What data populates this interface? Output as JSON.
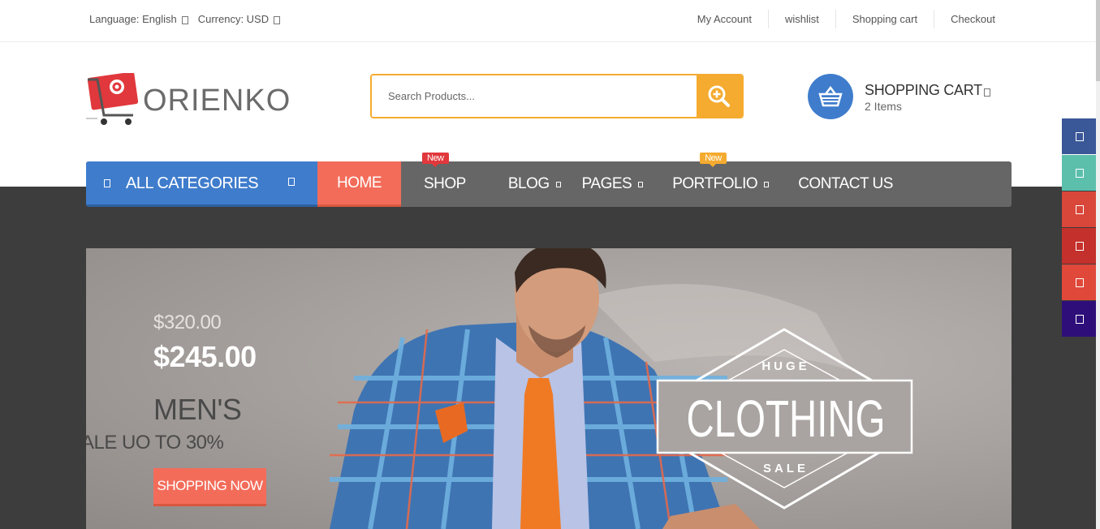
{
  "topbar": {
    "language": "Language: English",
    "currency": "Currency: USD",
    "links": [
      "My Account",
      "wishlist",
      "Shopping cart",
      "Checkout"
    ]
  },
  "logo": {
    "text": "ORIENKO"
  },
  "search": {
    "placeholder": "Search Products..."
  },
  "cart": {
    "title": "SHOPPING CART",
    "items": "2 Items"
  },
  "nav": {
    "categories_label": "ALL CATEGORIES",
    "items": [
      {
        "label": "HOME"
      },
      {
        "label": "SHOP",
        "badge": "New"
      },
      {
        "label": "BLOG"
      },
      {
        "label": "PAGES"
      },
      {
        "label": "PORTFOLIO",
        "badge": "New"
      },
      {
        "label": "CONTACT US"
      }
    ]
  },
  "hero": {
    "old_price": "$320.00",
    "price": "$245.00",
    "title": "MEN'S",
    "subtitle": "ALE UO TO 30%",
    "button": "SHOPPING NOW",
    "badge_top": "HUGE",
    "badge_main": "CLOTHING",
    "badge_bottom": "SALE"
  },
  "colors": {
    "accent_orange": "#f5ab2f",
    "accent_blue": "#3f7ccc",
    "accent_coral": "#f36c5a",
    "swatches": [
      "#3a5797",
      "#5bbfac",
      "#d9473a",
      "#c4302b",
      "#e0483a",
      "#2e0f7a"
    ]
  },
  "badge_colors": {
    "shop": "#e0383c",
    "portfolio": "#f5ab2f"
  }
}
